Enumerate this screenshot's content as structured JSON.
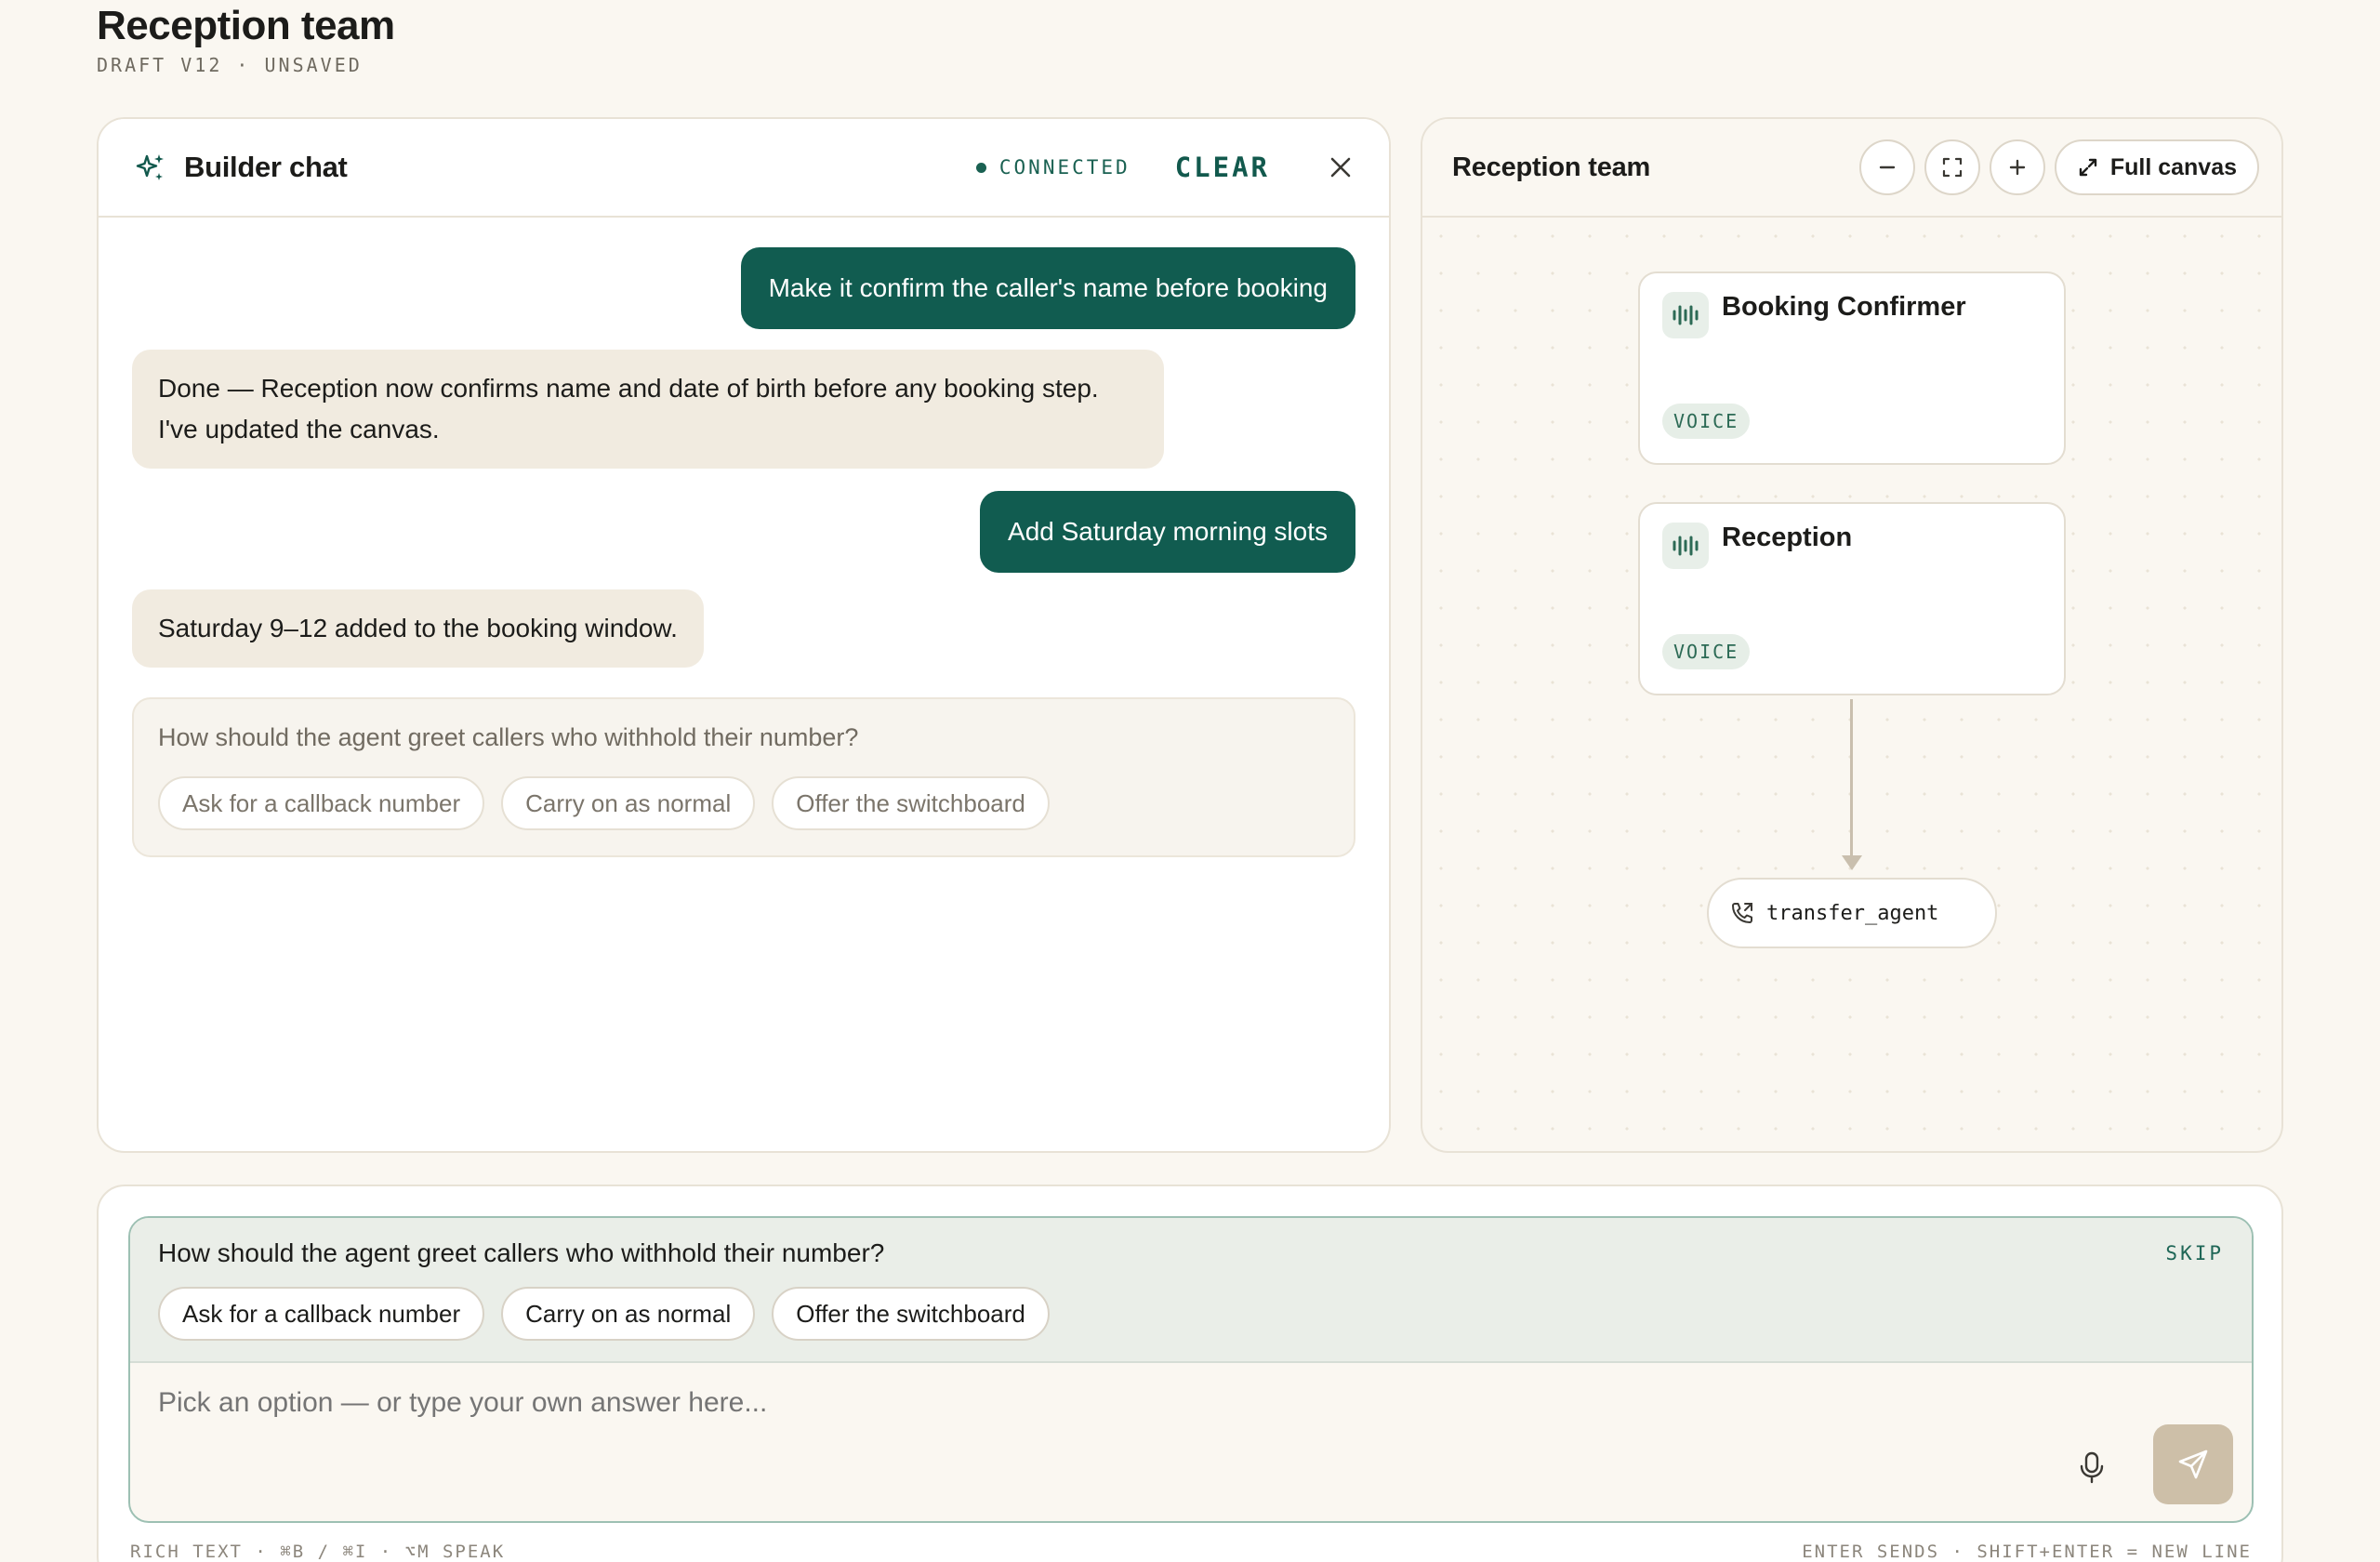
{
  "header": {
    "title": "Reception team",
    "subtitle": "DRAFT V12 · UNSAVED"
  },
  "chat": {
    "title": "Builder chat",
    "status": "CONNECTED",
    "clear_label": "CLEAR",
    "messages": [
      {
        "role": "user",
        "text": "Make it confirm the caller's name before booking"
      },
      {
        "role": "agent",
        "text": "Done — Reception now confirms name and date of birth before any booking step. I've updated the canvas."
      },
      {
        "role": "user",
        "text": "Add Saturday morning slots"
      },
      {
        "role": "agent",
        "text": "Saturday 9–12 added to the booking window."
      }
    ],
    "question": {
      "text": "How should the agent greet callers who withhold their number?",
      "options": [
        "Ask for a callback number",
        "Carry on as normal",
        "Offer the switchboard"
      ]
    }
  },
  "canvas": {
    "title": "Reception team",
    "full_canvas_label": "Full canvas",
    "nodes": [
      {
        "name": "Booking Confirmer",
        "badge": "VOICE"
      },
      {
        "name": "Reception",
        "badge": "VOICE"
      }
    ],
    "tool": "transfer_agent"
  },
  "composer": {
    "question": "How should the agent greet callers who withhold their number?",
    "skip_label": "SKIP",
    "options": [
      "Ask for a callback number",
      "Carry on as normal",
      "Offer the switchboard"
    ],
    "placeholder": "Pick an option — or type your own answer here...",
    "hint_left": "RICH TEXT · ⌘B / ⌘I · ⌥M SPEAK",
    "hint_right": "ENTER SENDS · SHIFT+ENTER = NEW LINE"
  },
  "colors": {
    "accent": "#115c50",
    "background": "#faf7f1",
    "agent_bubble": "#f1ebe0",
    "send_button": "#cdbfa8"
  }
}
